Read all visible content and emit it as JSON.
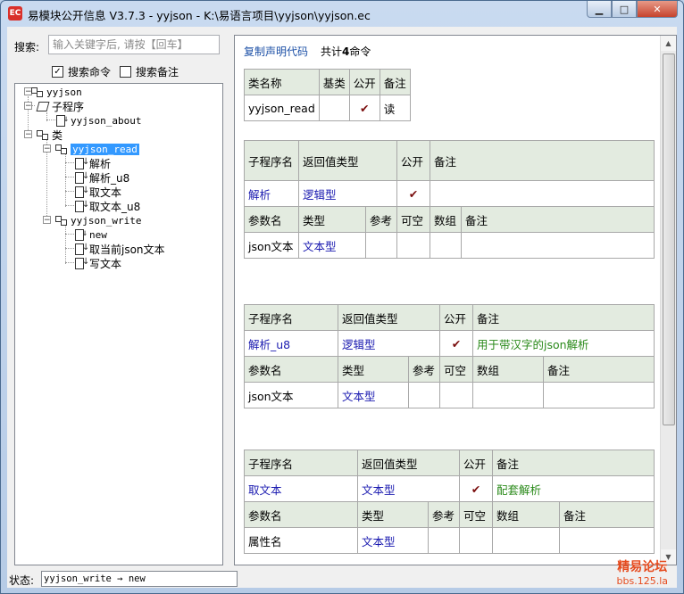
{
  "window": {
    "title": "易模块公开信息 V3.7.3 - yyjson - K:\\易语言项目\\yyjson\\yyjson.ec",
    "app_icon": "EC"
  },
  "search": {
    "label": "搜索:",
    "placeholder": "输入关键字后, 请按【回车】",
    "opt_commands": "搜索命令",
    "opt_notes": "搜索备注",
    "opt_commands_checked": true,
    "opt_notes_checked": false
  },
  "tree": {
    "root": "yyjson",
    "subprograms": "子程序",
    "about": "yyjson_about",
    "classes": "类",
    "class1": "yyjson_read",
    "class1_methods": [
      "解析",
      "解析_u8",
      "取文本",
      "取文本_u8"
    ],
    "class2": "yyjson_write",
    "class2_methods": [
      "new",
      "取当前json文本",
      "写文本"
    ]
  },
  "doc": {
    "copy_link": "复制声明代码",
    "total_prefix": "共计",
    "total_count": "4",
    "total_suffix": "命令",
    "class_table": {
      "headers": [
        "类名称",
        "基类",
        "公开",
        "备注"
      ],
      "row": {
        "name": "yyjson_read",
        "base": "",
        "public": "✔",
        "note": "读"
      }
    },
    "methods": [
      {
        "hdr_name": "子程序名",
        "hdr_ret": "返回值类型",
        "hdr_pub": "公开",
        "hdr_note": "备注",
        "name": "解析",
        "ret": "逻辑型",
        "pub": "✔",
        "note": "",
        "p_hdr_name": "参数名",
        "p_hdr_type": "类型",
        "p_hdr_ref": "参考",
        "p_hdr_null": "可空",
        "p_hdr_arr": "数组",
        "p_hdr_note": "备注",
        "param_name": "json文本",
        "param_type": "文本型"
      },
      {
        "hdr_name": "子程序名",
        "hdr_ret": "返回值类型",
        "hdr_pub": "公开",
        "hdr_note": "备注",
        "name": "解析_u8",
        "ret": "逻辑型",
        "pub": "✔",
        "note": "用于带汉字的json解析",
        "p_hdr_name": "参数名",
        "p_hdr_type": "类型",
        "p_hdr_ref": "参考",
        "p_hdr_null": "可空",
        "p_hdr_arr": "数组",
        "p_hdr_note": "备注",
        "param_name": "json文本",
        "param_type": "文本型"
      },
      {
        "hdr_name": "子程序名",
        "hdr_ret": "返回值类型",
        "hdr_pub": "公开",
        "hdr_note": "备注",
        "name": "取文本",
        "ret": "文本型",
        "pub": "✔",
        "note": "配套解析",
        "p_hdr_name": "参数名",
        "p_hdr_type": "类型",
        "p_hdr_ref": "参考",
        "p_hdr_null": "可空",
        "p_hdr_arr": "数组",
        "p_hdr_note": "备注",
        "param_name": "属性名",
        "param_type": "文本型"
      }
    ]
  },
  "status": {
    "label": "状态:",
    "text": "yyjson_write → new"
  },
  "watermark": {
    "line1": "精易论坛",
    "line2": "bbs.125.la"
  },
  "colors": {
    "header_bg": "#e3ebe0",
    "link": "#1b4fa6",
    "type_blue": "#1a1ab0",
    "note_green": "#2a8a1a",
    "tick": "#7a0d0d",
    "selection": "#3399ff"
  }
}
